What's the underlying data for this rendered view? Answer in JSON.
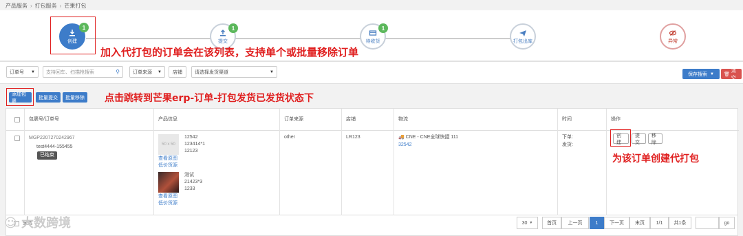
{
  "breadcrumb": [
    "产品服务",
    "打包服务",
    "芒果打包"
  ],
  "steps": [
    {
      "label": "创建",
      "badge": "1"
    },
    {
      "label": "提交",
      "badge": "1"
    },
    {
      "label": "待收货",
      "badge": "1"
    },
    {
      "label": "打包出库"
    },
    {
      "label": "异常"
    }
  ],
  "annotations": {
    "list_note": "加入代打包的订单会在该列表，支持单个或批量移除订单",
    "add_note": "点击跳转到芒果erp-订单-打包发货已发货状态下",
    "create_note": "为该订单创建代打包"
  },
  "filters": {
    "order_no": "订单号",
    "search_placeholder": "支持回车、扫描枪搜索",
    "order_source": "订单来源",
    "shop": "店铺",
    "channel_placeholder": "请选择发货渠道",
    "save_search": "保存搜索",
    "clear": "清空"
  },
  "actions": {
    "add": "添加包裹",
    "batch_submit": "批量提交",
    "batch_remove": "批量移除"
  },
  "table": {
    "headers": [
      "包裹号/订单号",
      "产品信息",
      "订单来源",
      "店铺",
      "物流",
      "时间",
      "操作"
    ],
    "row": {
      "package_no": "MGP2207270242967",
      "order_no": "test4444-155455",
      "status": "已结束",
      "products": [
        {
          "thumb": "50 x 50",
          "lines": [
            "12542",
            "123414*1",
            "12123"
          ],
          "view": "查看原图",
          "cheap": "低价货源"
        },
        {
          "lines": [
            "测试",
            "21423*3",
            "1233"
          ],
          "view": "查看原图",
          "cheap": "低价货源"
        }
      ],
      "source": "other",
      "shop": "LR123",
      "logistics": "CNE - CNE全球快捷 111",
      "tracking": "32542",
      "time_order": "下单:",
      "time_ship": "发货:",
      "op_create": "创建",
      "op_submit": "提交",
      "op_remove": "移除"
    }
  },
  "footer": {
    "select_all": "全选",
    "watermark": "大数跨境",
    "page_size": "30",
    "first": "首页",
    "prev": "上一页",
    "current": "1",
    "next": "下一页",
    "last": "末页",
    "page_ratio": "1/1",
    "total": "共1条",
    "go": "go"
  }
}
